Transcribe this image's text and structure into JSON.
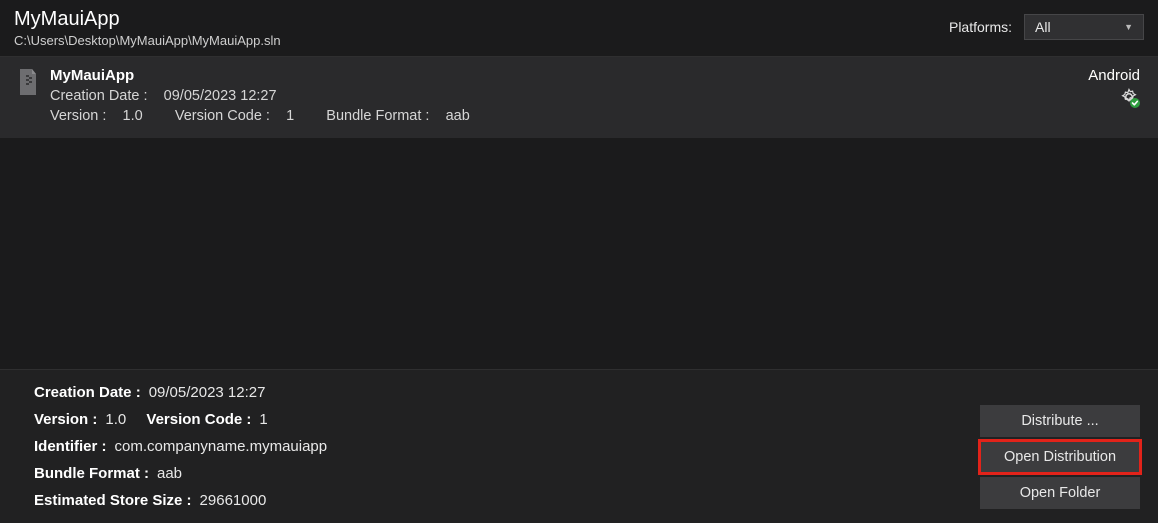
{
  "header": {
    "title": "MyMauiApp",
    "path": "C:\\Users\\Desktop\\MyMauiApp\\MyMauiApp.sln",
    "platforms_label": "Platforms:",
    "platforms_selected": "All"
  },
  "archive": {
    "name": "MyMauiApp",
    "creation_date_label": "Creation Date :",
    "creation_date": "09/05/2023 12:27",
    "version_label": "Version :",
    "version": "1.0",
    "version_code_label": "Version Code :",
    "version_code": "1",
    "bundle_format_label": "Bundle Format :",
    "bundle_format": "aab",
    "platform": "Android"
  },
  "details": {
    "creation_date_label": "Creation Date :",
    "creation_date": "09/05/2023 12:27",
    "version_label": "Version :",
    "version": "1.0",
    "version_code_label": "Version Code :",
    "version_code": "1",
    "identifier_label": "Identifier :",
    "identifier": "com.companyname.mymauiapp",
    "bundle_format_label": "Bundle Format :",
    "bundle_format": "aab",
    "estimated_size_label": "Estimated Store Size :",
    "estimated_size": "29661000"
  },
  "actions": {
    "distribute": "Distribute ...",
    "open_distribution": "Open Distribution",
    "open_folder": "Open Folder"
  }
}
